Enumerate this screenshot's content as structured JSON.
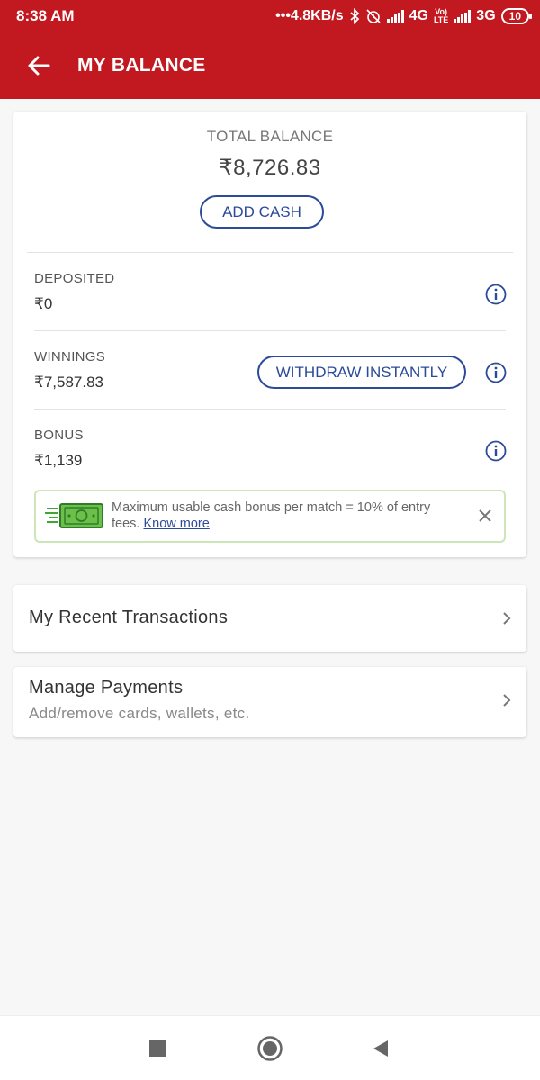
{
  "status_bar": {
    "time": "8:38 AM",
    "net_speed": "•••4.8KB/s",
    "network_1": "4G",
    "volte_top": "Vo)",
    "volte_bottom": "LTE",
    "network_2": "3G",
    "battery": "10"
  },
  "header": {
    "title": "MY BALANCE"
  },
  "balance": {
    "total_label": "TOTAL BALANCE",
    "total_amount": "₹8,726.83",
    "add_cash_label": "ADD CASH",
    "deposited_label": "DEPOSITED",
    "deposited_value": "₹0",
    "winnings_label": "WINNINGS",
    "winnings_value": "₹7,587.83",
    "withdraw_label": "WITHDRAW INSTANTLY",
    "bonus_label": "BONUS",
    "bonus_value": "₹1,139"
  },
  "bonus_note": {
    "text": "Maximum usable cash bonus per match = 10% of entry fees.",
    "link": "Know more"
  },
  "transactions": {
    "title": "My Recent Transactions"
  },
  "payments": {
    "title": "Manage Payments",
    "subtitle": "Add/remove cards, wallets, etc."
  },
  "colors": {
    "brand_red": "#c2181f",
    "accent_blue": "#2b4a9a",
    "cash_green": "#3fa535"
  },
  "icons": [
    "back-arrow-icon",
    "info-icon",
    "cash-icon",
    "close-icon",
    "chevron-right-icon",
    "stop-icon",
    "home-icon",
    "back-icon"
  ]
}
